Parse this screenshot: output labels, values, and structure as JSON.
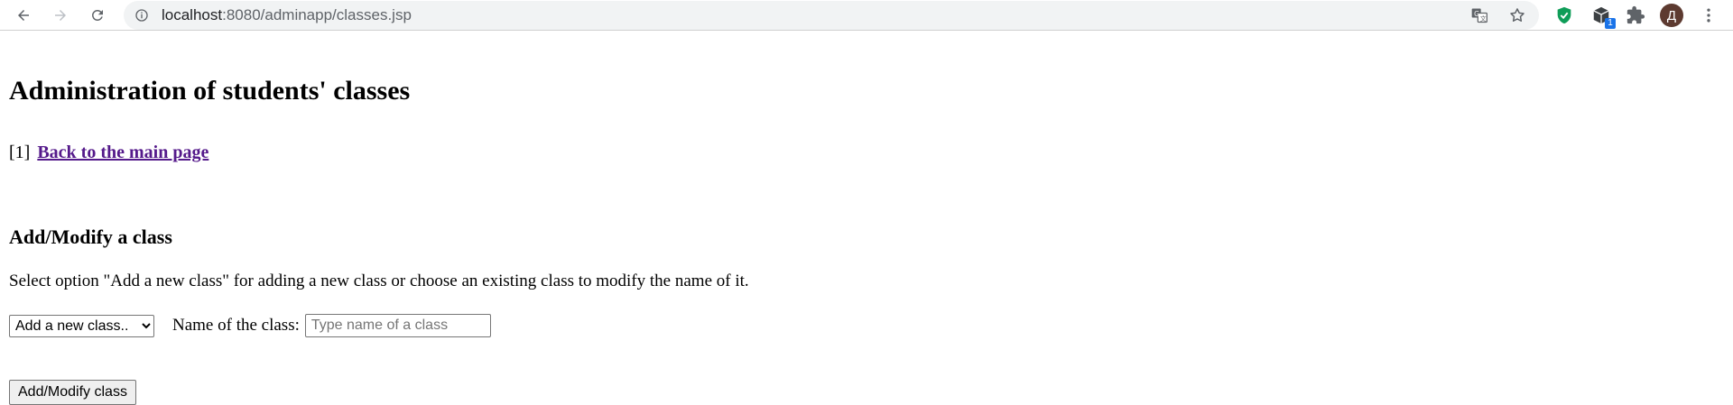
{
  "browser": {
    "url_host": "localhost",
    "url_rest": ":8080/adminapp/classes.jsp",
    "extension_badge": "1",
    "avatar_letter": "Д"
  },
  "page": {
    "title": "Administration of students' classes",
    "back_prefix": "[1]",
    "back_link": "Back to the main page",
    "section_title": "Add/Modify a class",
    "instruction": "Select option \"Add a new class\" for adding a new class or choose an existing class to modify the name of it.",
    "class_select": {
      "selected": "Add a new class.."
    },
    "name_label": "Name of the class:",
    "name_input": {
      "value": "",
      "placeholder": "Type name of a class"
    },
    "submit_label": "Add/Modify class"
  },
  "colors": {
    "link_visited": "#551a8b",
    "omnibox_bg": "#f1f3f4",
    "avatar_bg": "#5d3a30",
    "badge_bg": "#1a73e8"
  }
}
